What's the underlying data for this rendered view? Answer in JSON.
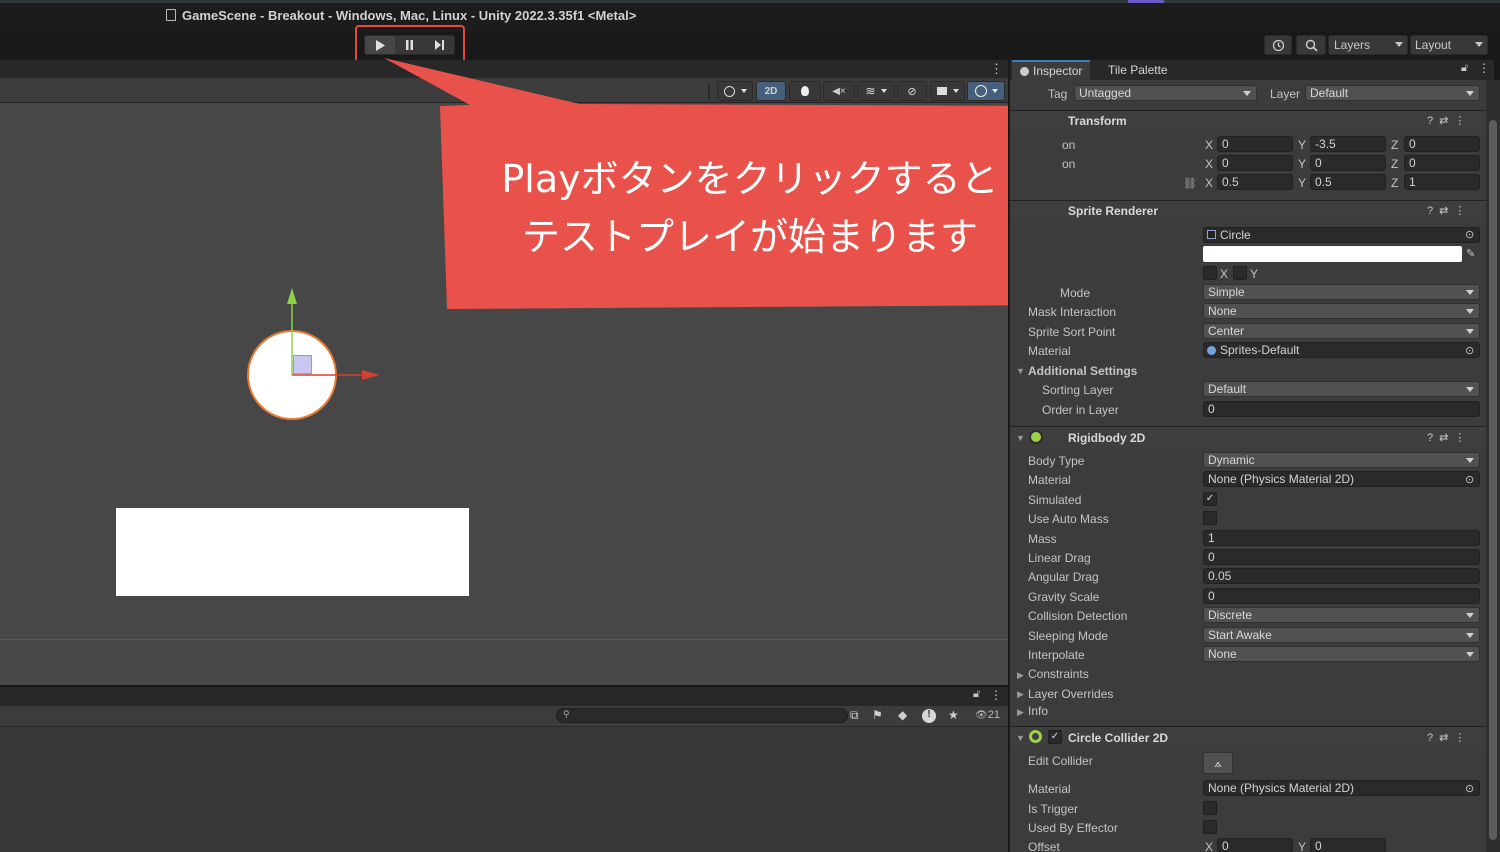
{
  "window": {
    "title": "GameScene - Breakout - Windows, Mac, Linux - Unity 2022.3.35f1 <Metal>"
  },
  "toolbar": {
    "layers_label": "Layers",
    "layout_label": "Layout"
  },
  "scene_toolbar": {
    "mode_2d_label": "2D"
  },
  "callout": {
    "line1": "Playボタンをクリックすると",
    "line2": "テストプレイが始まります",
    "color": "#e9524a"
  },
  "console": {
    "count": "21"
  },
  "inspector": {
    "tabs": [
      "Inspector",
      "Tile Palette"
    ],
    "tag_label": "Tag",
    "tag_value": "Untagged",
    "layer_label": "Layer",
    "layer_value": "Default",
    "transform": {
      "title": "Transform",
      "row1_label": "on",
      "row2_label": "on",
      "position": {
        "x": "0",
        "y": "-3.5",
        "z": "0"
      },
      "rotation": {
        "x": "0",
        "y": "0",
        "z": "0"
      },
      "scale": {
        "x": "0.5",
        "y": "0.5",
        "z": "1"
      }
    },
    "sprite_renderer": {
      "title": "Sprite Renderer",
      "sprite_value": "Circle",
      "flip_x": "X",
      "flip_y": "Y",
      "draw_mode_label": "Mode",
      "draw_mode_value": "Simple",
      "mask_label": "Mask Interaction",
      "mask_value": "None",
      "sort_point_label": "Sprite Sort Point",
      "sort_point_value": "Center",
      "material_label": "Material",
      "material_value": "Sprites-Default",
      "additional_label": "Additional Settings",
      "sorting_layer_label": "Sorting Layer",
      "sorting_layer_value": "Default",
      "order_label": "Order in Layer",
      "order_value": "0"
    },
    "rigidbody": {
      "title": "Rigidbody 2D",
      "body_type_label": "Body Type",
      "body_type_value": "Dynamic",
      "material_label": "Material",
      "material_value": "None (Physics Material 2D)",
      "simulated_label": "Simulated",
      "auto_mass_label": "Use Auto Mass",
      "mass_label": "Mass",
      "mass_value": "1",
      "linear_drag_label": "Linear Drag",
      "linear_drag_value": "0",
      "angular_drag_label": "Angular Drag",
      "angular_drag_value": "0.05",
      "gravity_label": "Gravity Scale",
      "gravity_value": "0",
      "collision_label": "Collision Detection",
      "collision_value": "Discrete",
      "sleeping_label": "Sleeping Mode",
      "sleeping_value": "Start Awake",
      "interpolate_label": "Interpolate",
      "interpolate_value": "None",
      "constraints_label": "Constraints",
      "overrides_label": "Layer Overrides",
      "info_label": "Info"
    },
    "circle_collider": {
      "title": "Circle Collider 2D",
      "edit_label": "Edit Collider",
      "material_label": "Material",
      "material_value": "None (Physics Material 2D)",
      "trigger_label": "Is Trigger",
      "effector_label": "Used By Effector",
      "offset_label": "Offset",
      "offset": {
        "x": "0",
        "y": "0"
      }
    }
  }
}
